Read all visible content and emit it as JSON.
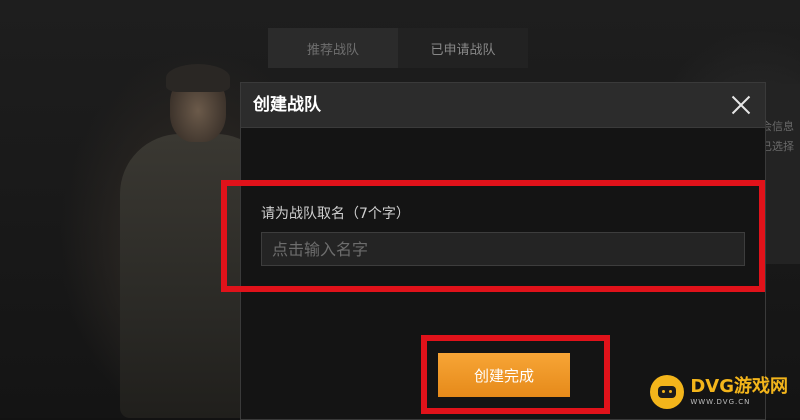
{
  "background": {
    "tabs": [
      {
        "label": "推荐战队",
        "active": true
      },
      {
        "label": "已申请战队",
        "active": false
      }
    ],
    "side_text": [
      "会信息",
      "已选择"
    ]
  },
  "dialog": {
    "title": "创建战队",
    "field_label": "请为战队取名（7个字）",
    "input_value": "",
    "input_placeholder": "点击输入名字",
    "submit_label": "创建完成"
  },
  "watermark": {
    "main": "DVG游戏网",
    "sub": "WWW.DVG.CN"
  },
  "colors": {
    "accent_orange": "#f09a28",
    "highlight_red": "#e0121a",
    "watermark_yellow": "#f3b51b"
  }
}
